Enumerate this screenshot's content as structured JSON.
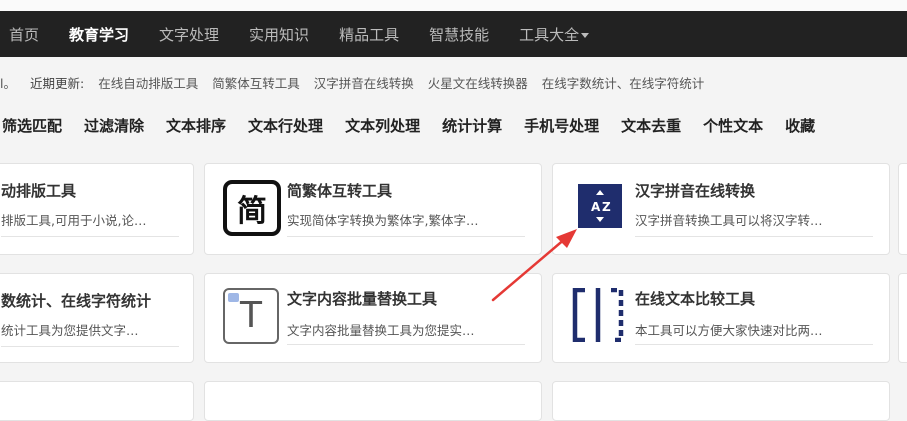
{
  "nav": {
    "items": [
      "首页",
      "教育学习",
      "文字处理",
      "实用知识",
      "精品工具",
      "智慧技能",
      "工具大全"
    ]
  },
  "updates": {
    "lead": "l。",
    "label": "近期更新:",
    "items": [
      "在线自动排版工具",
      "简繁体互转工具",
      "汉字拼音在线转换",
      "火星文在线转换器",
      "在线字数统计、在线字符统计"
    ]
  },
  "categories": [
    "筛选匹配",
    "过滤清除",
    "文本排序",
    "文本行处理",
    "文本列处理",
    "统计计算",
    "手机号处理",
    "文本去重",
    "个性文本",
    "收藏"
  ],
  "cards": [
    {
      "title": "动排版工具",
      "desc": "排版工具,可用于小说,论…"
    },
    {
      "title": "简繁体互转工具",
      "desc": "实现简体字转换为繁体字,繁体字…",
      "icon": "jian-char-icon",
      "glyph": "简"
    },
    {
      "title": "汉字拼音在线转换",
      "desc": "汉字拼音转换工具可以将汉字转…",
      "icon": "az-sort-icon",
      "glyph_top": "A",
      "glyph_bottom": "Z"
    },
    {
      "title": "数统计、在线字符统计",
      "desc": "统计工具为您提供文字…"
    },
    {
      "title": "文字内容批量替换工具",
      "desc": "文字内容批量替换工具为您提实…",
      "icon": "text-t-icon",
      "glyph": "T"
    },
    {
      "title": "在线文本比较工具",
      "desc": "本工具可以方便大家快速对比两…",
      "icon": "compare-icon"
    }
  ],
  "colors": {
    "navbar": "#222222",
    "az_icon": "#1f2d6d",
    "compare_icon": "#1f2d6d",
    "arrow": "#e53935"
  }
}
